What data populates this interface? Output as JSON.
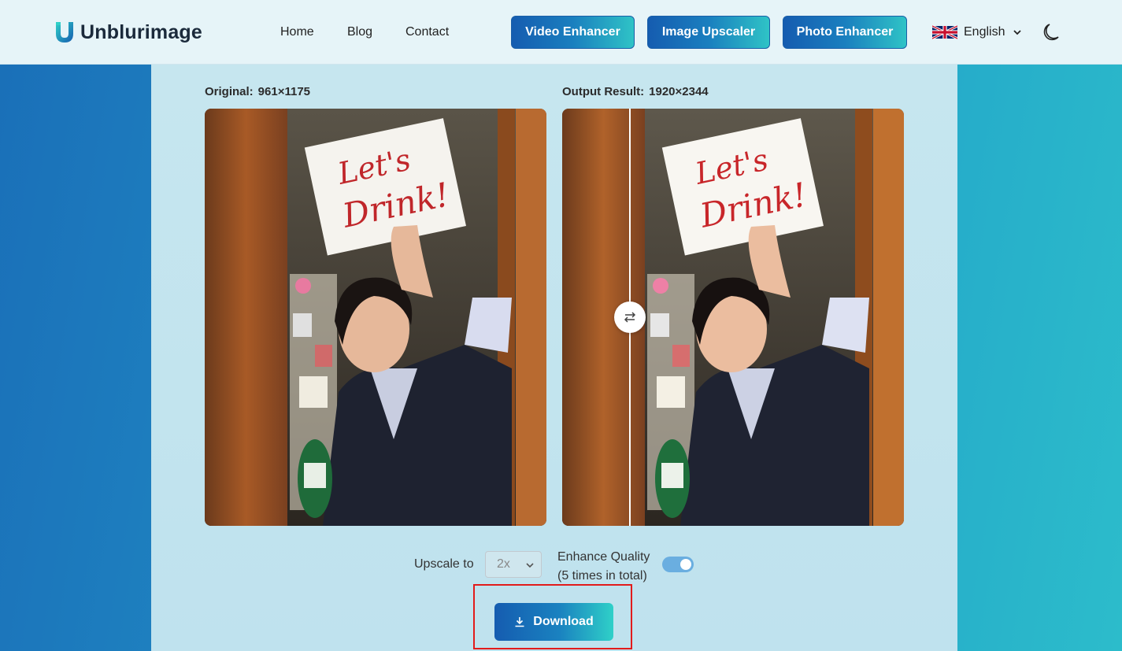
{
  "header": {
    "brand": "Unblurimage",
    "nav": [
      "Home",
      "Blog",
      "Contact"
    ],
    "buttons": [
      "Video Enhancer",
      "Image Upscaler",
      "Photo Enhancer"
    ],
    "language": "English"
  },
  "compare": {
    "original_label": "Original:",
    "original_size": "961×1175",
    "output_label": "Output Result:",
    "output_size": "1920×2344",
    "sign_line1": "Let's",
    "sign_line2": "Drink!"
  },
  "controls": {
    "upscale_label": "Upscale to",
    "upscale_value": "2x",
    "enhance_label_line1": "Enhance Quality",
    "enhance_label_line2": "(5 times in total)",
    "enhance_enabled": true,
    "download_label": "Download"
  },
  "colors": {
    "accent": "#155cb0",
    "accent_end": "#2fc3c6",
    "highlight": "#e21b1b"
  }
}
